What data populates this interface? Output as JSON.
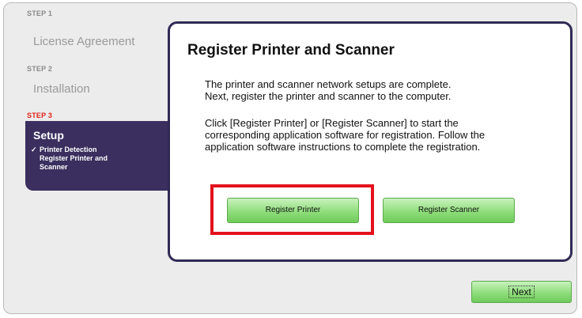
{
  "sidebar": {
    "steps": [
      {
        "label": "STEP 1",
        "title": "License Agreement"
      },
      {
        "label": "STEP 2",
        "title": "Installation"
      },
      {
        "label": "STEP 3",
        "title": "Setup",
        "items": [
          "Printer Detection",
          "Register Printer and Scanner"
        ]
      }
    ]
  },
  "main": {
    "title": "Register Printer and Scanner",
    "paragraph1_line1": "The printer and scanner network setups are complete.",
    "paragraph1_line2": "Next, register the printer and scanner to the computer.",
    "paragraph2_line1": "Click [Register Printer] or [Register Scanner] to start the",
    "paragraph2_line2": "corresponding application software for registration. Follow the",
    "paragraph2_line3": "application software instructions to complete the registration.",
    "register_printer_label": "Register Printer",
    "register_scanner_label": "Register Scanner"
  },
  "footer": {
    "next_label": "Next"
  },
  "colors": {
    "active_step": "#3a2f5e",
    "step3_label": "#e0231a",
    "button_green": "#8fdd7c",
    "highlight": "#e3121d"
  }
}
